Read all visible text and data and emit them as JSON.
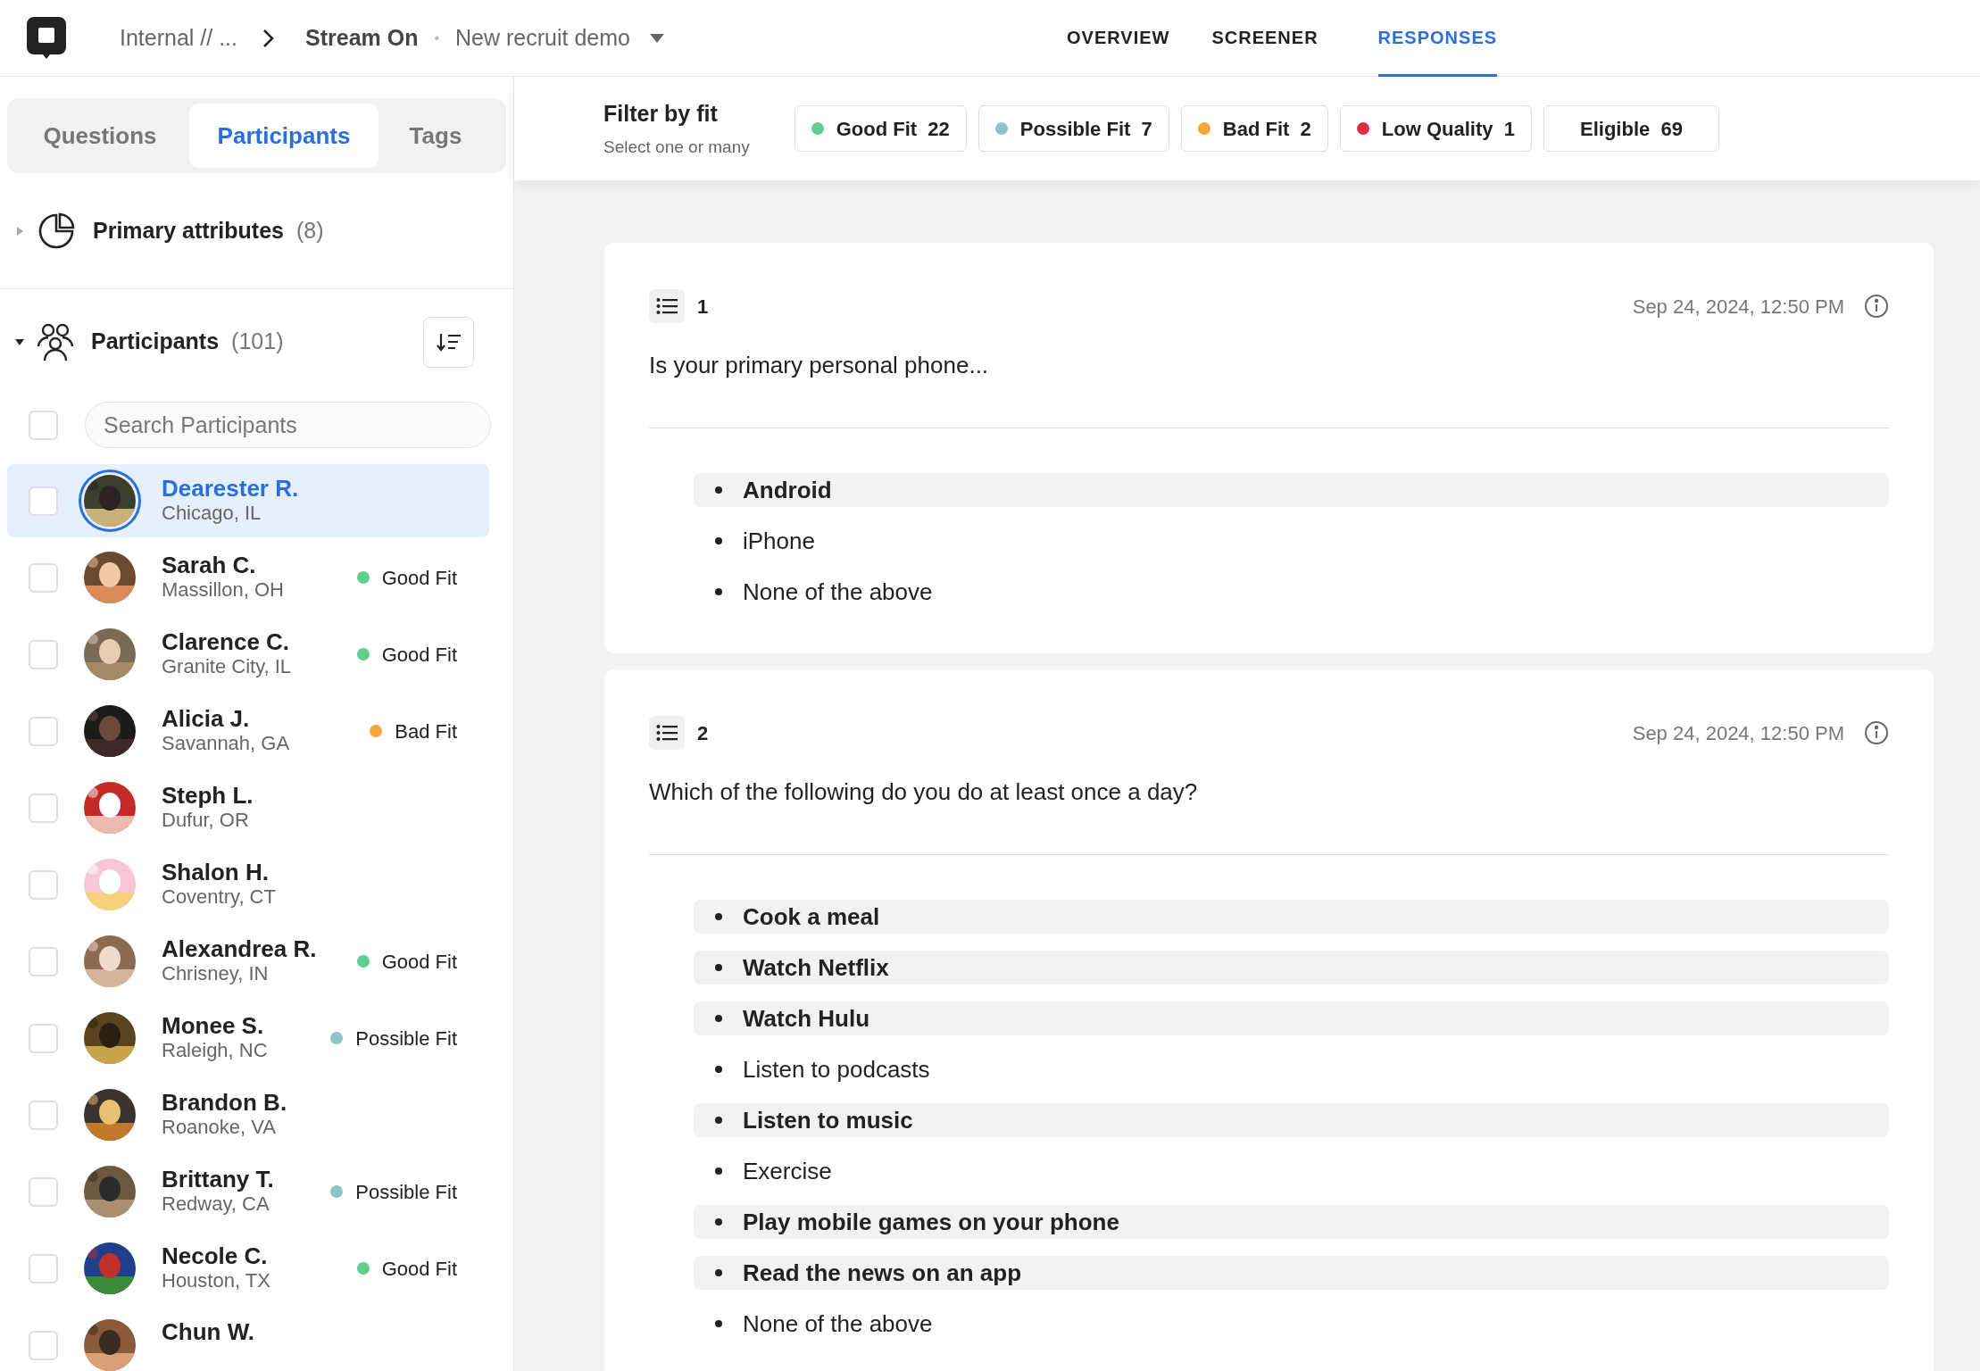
{
  "breadcrumb": {
    "workspace": "Internal // ...",
    "study": "Stream On",
    "separator": "•",
    "project": "New recruit demo"
  },
  "nav": [
    {
      "label": "OVERVIEW",
      "selected": false
    },
    {
      "label": "SCREENER",
      "selected": false
    },
    {
      "label": "RESPONSES",
      "selected": true
    }
  ],
  "sidebar_tabs": [
    {
      "label": "Questions",
      "selected": false
    },
    {
      "label": "Participants",
      "selected": true
    },
    {
      "label": "Tags",
      "selected": false
    }
  ],
  "primary_attributes": {
    "label": "Primary attributes",
    "count": "(8)",
    "expanded": false
  },
  "participants_section": {
    "label": "Participants",
    "count": "(101)",
    "expanded": true
  },
  "search": {
    "placeholder": "Search Participants",
    "select_all_checked": false
  },
  "participants": [
    {
      "name": "Dearester R.",
      "location": "Chicago, IL",
      "selected": true,
      "checked": false
    },
    {
      "name": "Sarah C.",
      "location": "Massillon, OH",
      "selected": false,
      "checked": false,
      "fit": "Good Fit",
      "color": "#5fcf8f"
    },
    {
      "name": "Clarence C.",
      "location": "Granite City, IL",
      "selected": false,
      "checked": false,
      "fit": "Good Fit",
      "color": "#5fcf8f"
    },
    {
      "name": "Alicia J.",
      "location": "Savannah, GA",
      "selected": false,
      "checked": false,
      "fit": "Bad Fit",
      "color": "#f5a83a"
    },
    {
      "name": "Steph L.",
      "location": "Dufur, OR",
      "selected": false,
      "checked": false
    },
    {
      "name": "Shalon H.",
      "location": "Coventry, CT",
      "selected": false,
      "checked": false
    },
    {
      "name": "Alexandrea R.",
      "location": "Chrisney, IN",
      "selected": false,
      "checked": false,
      "fit": "Good Fit",
      "color": "#5fcf8f"
    },
    {
      "name": "Monee S.",
      "location": "Raleigh, NC",
      "selected": false,
      "checked": false,
      "fit": "Possible Fit",
      "color": "#8fc3c8"
    },
    {
      "name": "Brandon B.",
      "location": "Roanoke, VA",
      "selected": false,
      "checked": false
    },
    {
      "name": "Brittany T.",
      "location": "Redway, CA",
      "selected": false,
      "checked": false,
      "fit": "Possible Fit",
      "color": "#8fc3c8"
    },
    {
      "name": "Necole C.",
      "location": "Houston, TX",
      "selected": false,
      "checked": false,
      "fit": "Good Fit",
      "color": "#5fcf8f"
    },
    {
      "name": "Chun W.",
      "selected": false,
      "checked": false
    }
  ],
  "filter": {
    "title": "Filter by fit",
    "subtitle": "Select one or many",
    "chips": [
      {
        "label": "Good Fit",
        "count": "22",
        "color": "#5fcf8f",
        "selected": false
      },
      {
        "label": "Possible Fit",
        "count": "7",
        "color": "#8fc3c8",
        "selected": false
      },
      {
        "label": "Bad Fit",
        "count": "2",
        "color": "#f5a83a",
        "selected": false
      },
      {
        "label": "Low Quality",
        "count": "1",
        "color": "#d9304a",
        "selected": false
      },
      {
        "label": "Eligible",
        "count": "69",
        "selected": false
      }
    ]
  },
  "responses": [
    {
      "number": "1",
      "date": "Sep 24, 2024, 12:50 PM",
      "question": "Is your primary personal phone...",
      "answers": [
        {
          "text": "Android",
          "selected": true
        },
        {
          "text": "iPhone",
          "selected": false
        },
        {
          "text": "None of the above",
          "selected": false
        }
      ]
    },
    {
      "number": "2",
      "date": "Sep 24, 2024, 12:50 PM",
      "question": "Which of the following do you do at least once a day?",
      "answers": [
        {
          "text": "Cook a meal",
          "selected": true
        },
        {
          "text": "Watch Netflix",
          "selected": true
        },
        {
          "text": "Watch Hulu",
          "selected": true
        },
        {
          "text": "Listen to podcasts",
          "selected": false
        },
        {
          "text": "Listen to music",
          "selected": true
        },
        {
          "text": "Exercise",
          "selected": false
        },
        {
          "text": "Play mobile games on your phone",
          "selected": true
        },
        {
          "text": "Read the news on an app",
          "selected": true
        },
        {
          "text": "None of the above",
          "selected": false
        }
      ]
    }
  ]
}
